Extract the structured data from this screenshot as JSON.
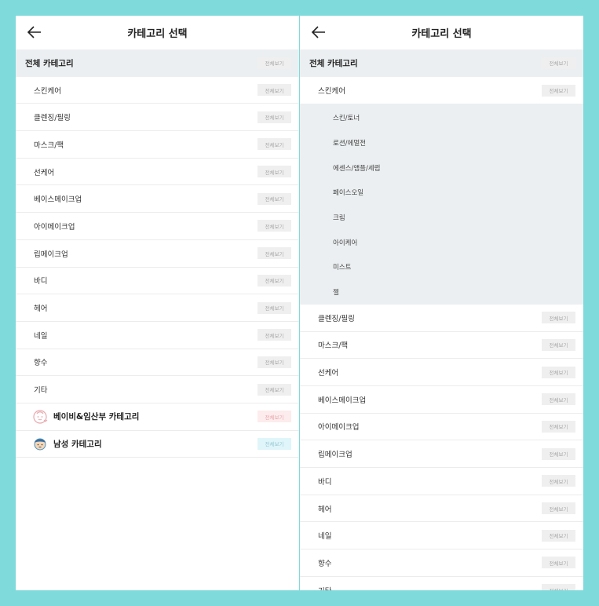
{
  "header": {
    "title": "카테고리 선택"
  },
  "all_label": "전체 카테고리",
  "view_all": "전체보기",
  "categories": [
    "스킨케어",
    "클렌징/필링",
    "마스크/팩",
    "선케어",
    "베이스메이크업",
    "아이메이크업",
    "립메이크업",
    "바디",
    "헤어",
    "네일",
    "향수",
    "기타"
  ],
  "special": [
    {
      "label": "베이비&임산부 카테고리",
      "icon": "baby-face-icon",
      "color": "#e7a8ad"
    },
    {
      "label": "남성 카테고리",
      "icon": "man-face-icon",
      "color": "#4a90c2"
    }
  ],
  "skincare_sub": [
    "스킨/토너",
    "로션/에멀전",
    "에센스/앰플/세럼",
    "페이스오일",
    "크림",
    "아이케어",
    "미스트",
    "젤"
  ]
}
